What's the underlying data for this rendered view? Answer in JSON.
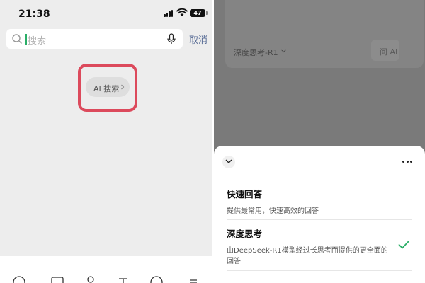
{
  "left_screen": {
    "status_bar": {
      "time": "21:38",
      "battery": "47"
    },
    "search": {
      "placeholder": "搜索",
      "cancel_label": "取消"
    },
    "ai_search_button": {
      "label": "AI 搜索"
    }
  },
  "right_screen": {
    "background_card": {
      "model_label": "深度思考-R1",
      "ask_label": "问 AI"
    },
    "model_sheet": {
      "options": [
        {
          "title": "快速回答",
          "description": "提供最常用，快速高效的回答",
          "selected": false
        },
        {
          "title": "深度思考",
          "description": "由DeepSeek-R1模型经过长思考而提供的更全面的回答",
          "selected": true
        }
      ]
    }
  },
  "colors": {
    "accent_green": "#2aae67",
    "link_blue": "#576b95",
    "highlight_red": "#dc4a5c"
  }
}
